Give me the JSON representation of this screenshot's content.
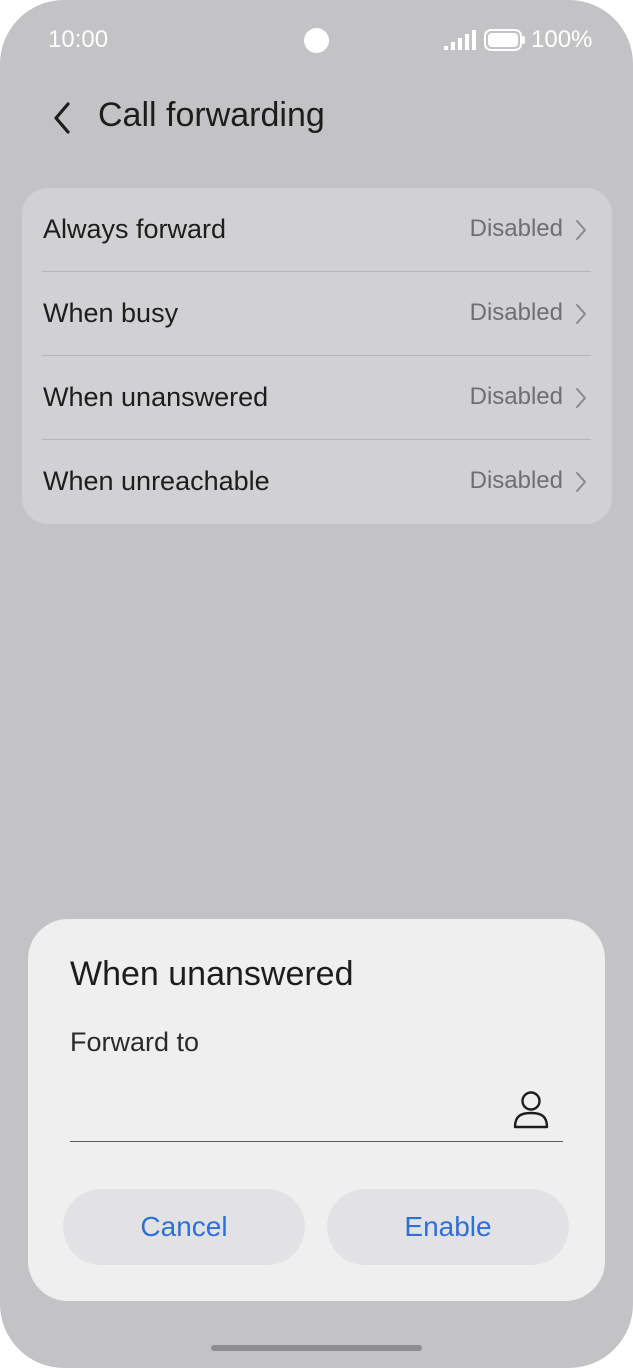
{
  "status_bar": {
    "time": "10:00",
    "battery_percent": "100%",
    "battery_level": 1.0,
    "signal_icon": "signal-bars-icon"
  },
  "header": {
    "back_icon": "chevron-left-icon",
    "title": "Call forwarding"
  },
  "settings": {
    "items": [
      {
        "label": "Always forward",
        "value": "Disabled"
      },
      {
        "label": "When busy",
        "value": "Disabled"
      },
      {
        "label": "When unanswered",
        "value": "Disabled"
      },
      {
        "label": "When unreachable",
        "value": "Disabled"
      }
    ]
  },
  "dialog": {
    "title": "When unanswered",
    "field_label": "Forward to",
    "field_value": "",
    "contact_icon": "person-icon",
    "cancel_label": "Cancel",
    "enable_label": "Enable"
  },
  "colors": {
    "background_dim": "#c3c3c5",
    "card": "#d1d1d3",
    "dialog": "#efeff0",
    "accent": "#2e6fd9",
    "text_primary": "#1d1d1d",
    "text_secondary": "#6f6f72"
  }
}
